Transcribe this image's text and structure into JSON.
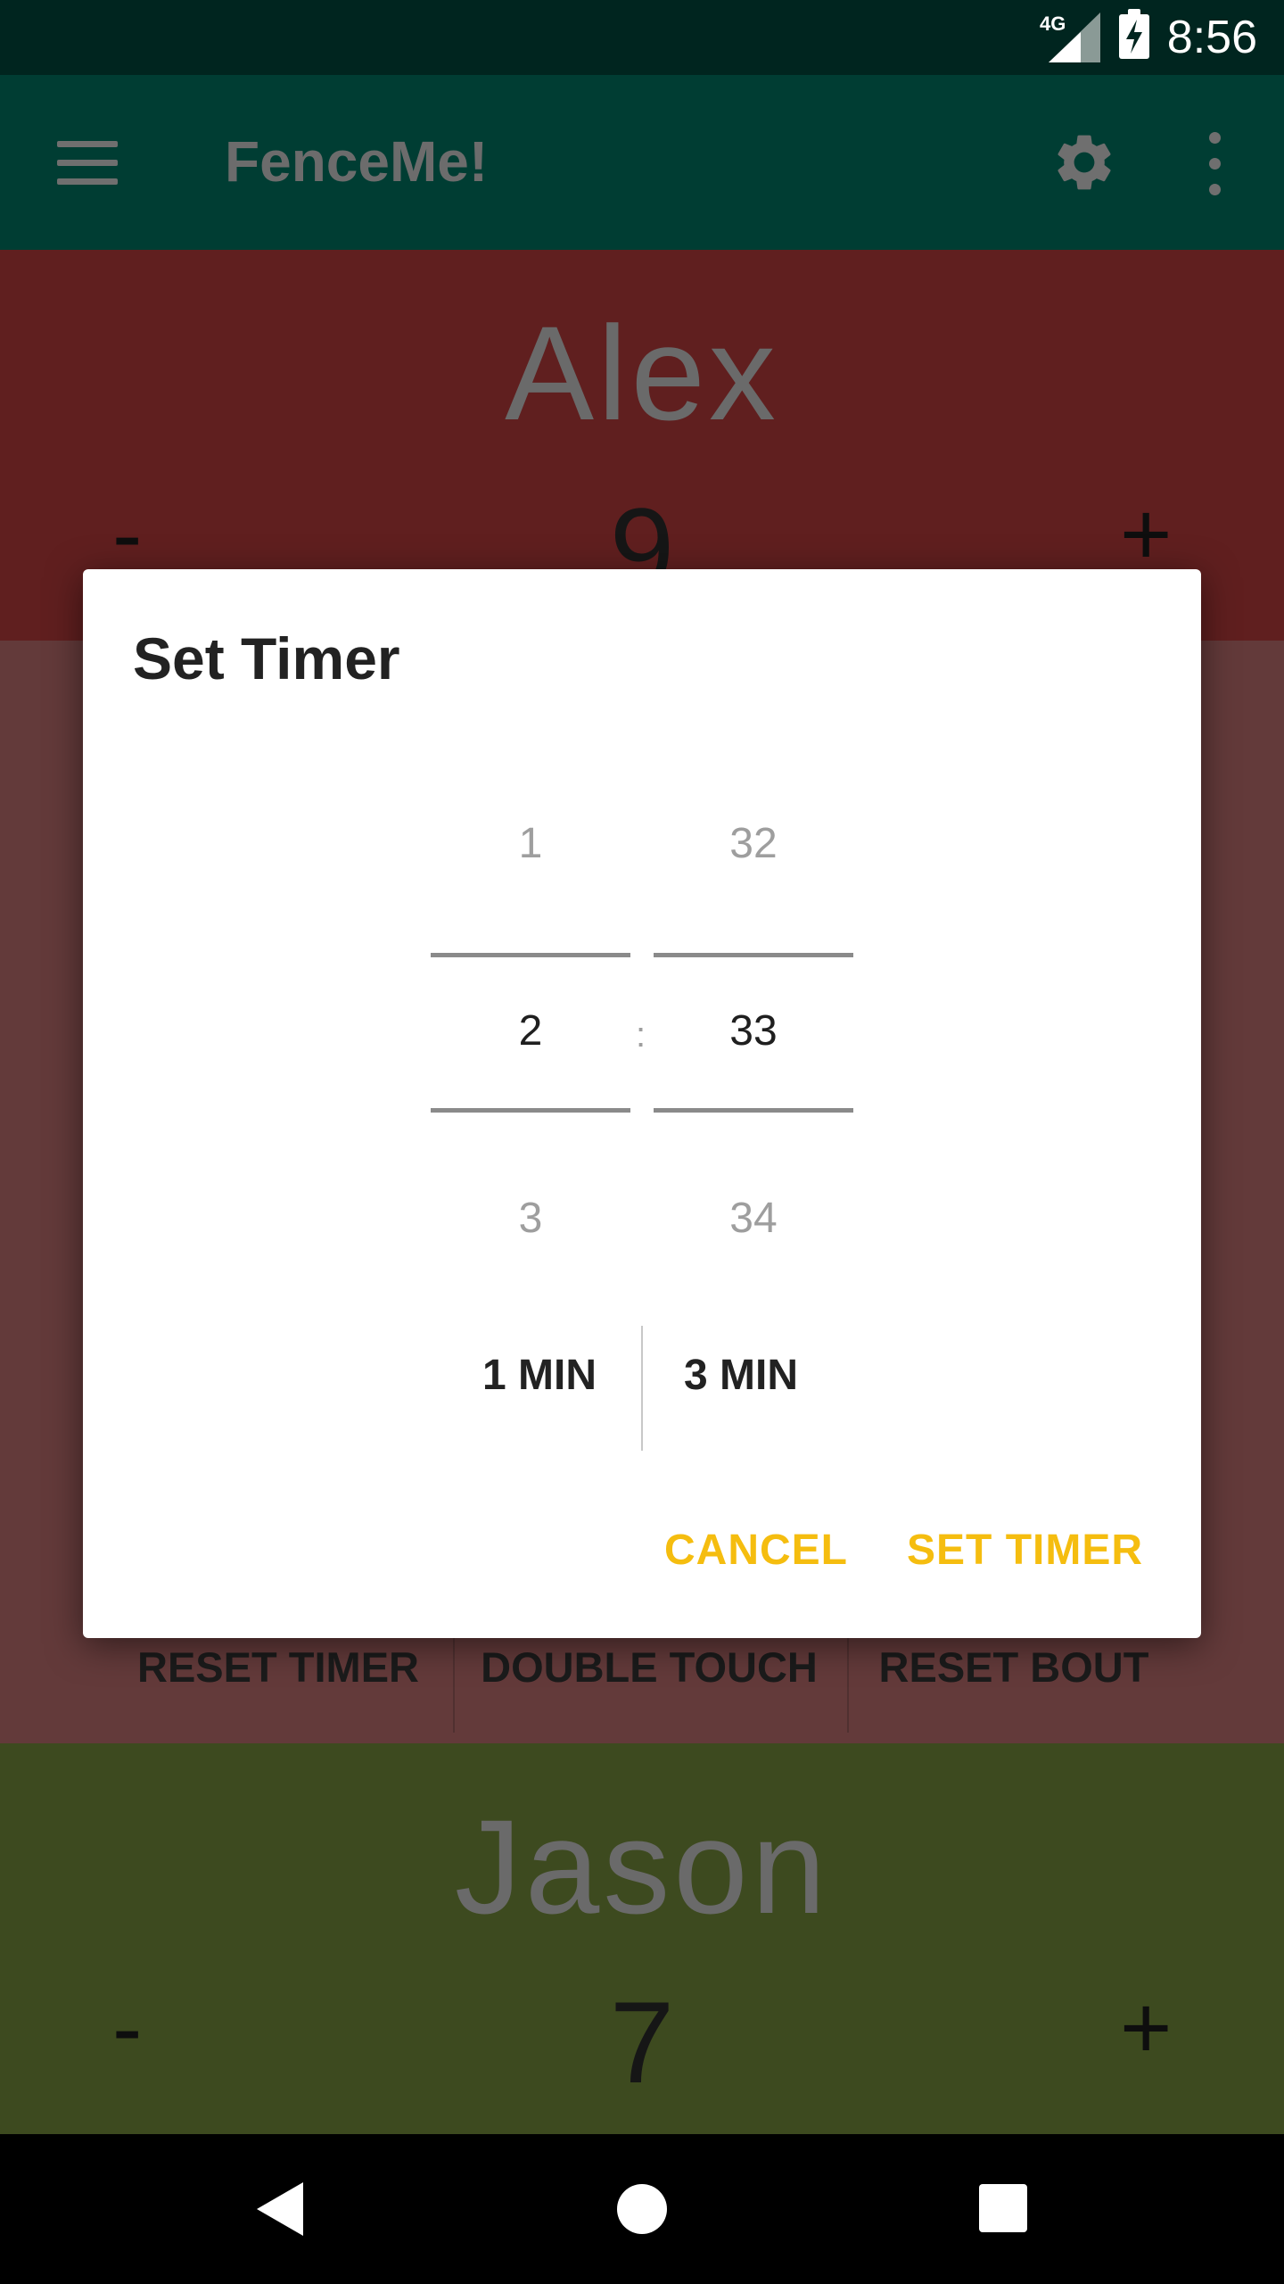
{
  "status_bar": {
    "network": "4G",
    "time": "8:56"
  },
  "app_bar": {
    "title": "FenceMe!"
  },
  "fencer_top": {
    "name": "Alex",
    "score": "9",
    "minus_label": "-",
    "plus_label": "+"
  },
  "fencer_bottom": {
    "name": "Jason",
    "score": "7",
    "minus_label": "-",
    "plus_label": "+"
  },
  "controls": {
    "reset_timer": "RESET TIMER",
    "double_touch": "DOUBLE TOUCH",
    "reset_bout": "RESET BOUT"
  },
  "dialog": {
    "title": "Set Timer",
    "minutes": {
      "above": "1",
      "selected": "2",
      "below": "3"
    },
    "seconds": {
      "above": "32",
      "selected": "33",
      "below": "34"
    },
    "separator": ":",
    "presets": {
      "left": "1 MIN",
      "right": "3 MIN"
    },
    "cancel_label": "CANCEL",
    "confirm_label": "SET TIMER"
  },
  "colors": {
    "status_bar": "#00251f",
    "app_bar": "#003d33",
    "top_panel": "#601f1f",
    "mid_panel": "#633a3a",
    "bottom_panel": "#3d4a1f",
    "accent": "#f5bd0f"
  }
}
